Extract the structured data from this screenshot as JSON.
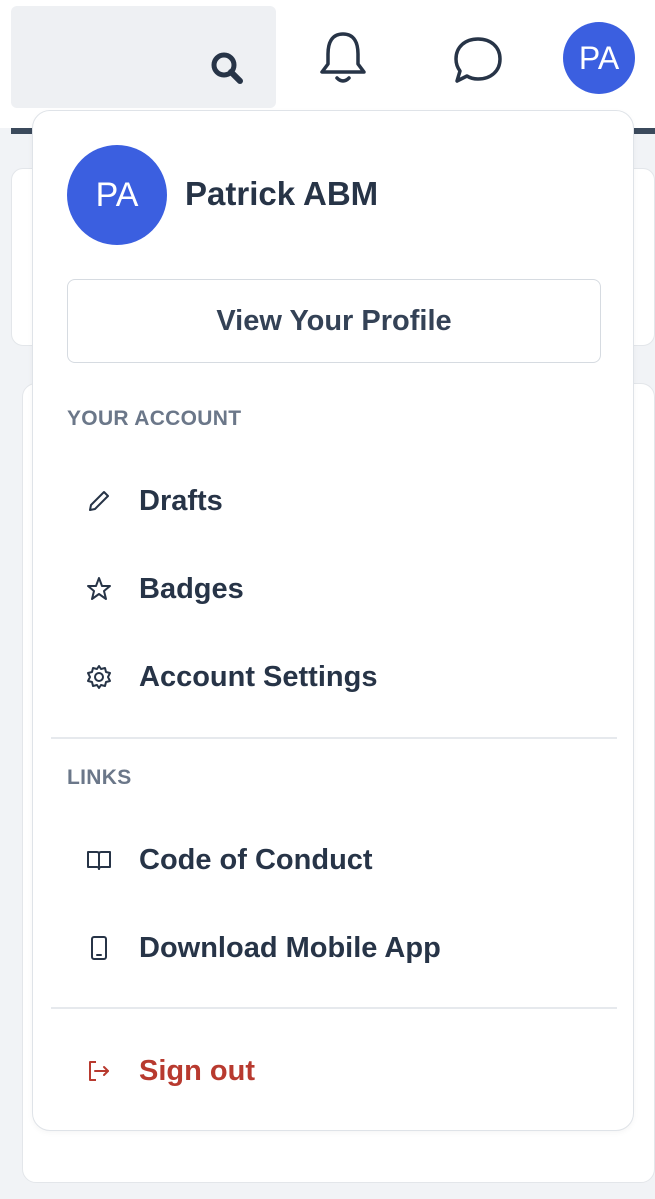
{
  "header": {
    "search_icon": "search-icon",
    "bell_icon": "bell-icon",
    "chat_icon": "chat-bubble-icon",
    "avatar_initials": "PA"
  },
  "dropdown": {
    "avatar_initials": "PA",
    "user_name": "Patrick ABM",
    "view_profile_label": "View Your Profile",
    "account_section": {
      "title": "YOUR ACCOUNT",
      "items": [
        {
          "label": "Drafts",
          "icon": "pencil-icon"
        },
        {
          "label": "Badges",
          "icon": "star-icon"
        },
        {
          "label": "Account Settings",
          "icon": "gear-icon"
        }
      ]
    },
    "links_section": {
      "title": "LINKS",
      "items": [
        {
          "label": "Code of Conduct",
          "icon": "book-icon"
        },
        {
          "label": "Download Mobile App",
          "icon": "phone-icon"
        }
      ]
    },
    "sign_out": {
      "label": "Sign out",
      "icon": "sign-out-icon"
    }
  },
  "colors": {
    "avatar_bg": "#3b5fe0",
    "text_primary": "#273447",
    "section_heading": "#6b7789",
    "danger": "#b83a2f"
  }
}
